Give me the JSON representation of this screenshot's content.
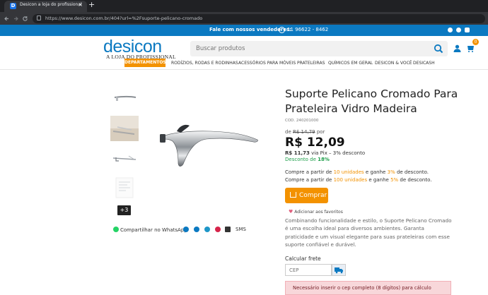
{
  "browser": {
    "tab_title": "Desicon a loja do profissional",
    "tab_favicon": "D",
    "close_glyph": "×",
    "newtab_glyph": "+",
    "url": "https://www.desicon.com.br/404?url=%2Fsuporte-pelicano-cromado"
  },
  "topbar": {
    "label": "Fale com nossos vendedores:",
    "phone": "11 96622 - 8462"
  },
  "header": {
    "logo_word": "desicon",
    "logo_tag": "A LOJA DO PROFISSIONAL",
    "search_placeholder": "Buscar produtos",
    "cart_count": "0"
  },
  "nav": {
    "departments": "DEPARTAMENTOS",
    "items": [
      "RODÍZIOS, RODAS E RODINHAS",
      "ACESSÓRIOS PARA MÓVEIS",
      "PRATELEIRAS",
      "QUÍMICOS EM GERAL",
      "DESICON & VOCÊ",
      "DESICASH"
    ]
  },
  "gallery": {
    "more_label": "+3",
    "share_label": "Compartilhar no WhatsApp",
    "sms_label": "SMS"
  },
  "product": {
    "title": "Suporte Pelicano Cromado Para Prateleira Vidro Madeira",
    "code": "COD. 240201000",
    "old_price_prefix": "de",
    "old_price": "R$ 14,79",
    "old_price_suffix": "por",
    "price": "R$ 12,09",
    "pix_price": "R$ 11,73",
    "pix_text": "via Pix – 3% desconto",
    "discount_label": "Desconto de",
    "discount_value": "18%",
    "bulk": [
      {
        "pre": "Compre a partir de",
        "qty": "10 unidades",
        "mid": "e ganhe",
        "pct": "3%",
        "post": "de desconto."
      },
      {
        "pre": "Compre a partir de",
        "qty": "100 unidades",
        "mid": "e ganhe",
        "pct": "5%",
        "post": "de desconto."
      }
    ],
    "buy_label": "Comprar",
    "favorites_label": "Adicionar aos favoritos",
    "description": "Combinando funcionalidade e estilo, o Suporte Pelicano Cromado é uma escolha ideal para diversos ambientes. Garanta praticidade e um visual elegante para suas prateleiras com esse suporte confiável e durável."
  },
  "shipping": {
    "label": "Calcular frete",
    "cep_placeholder": "CEP",
    "alert": "Necessário inserir o cep completo (8 dígitos) para cálculo"
  },
  "colors": {
    "brand_blue": "#0b79c1",
    "accent_orange": "#f39200",
    "discount_green": "#1e9e4a"
  }
}
